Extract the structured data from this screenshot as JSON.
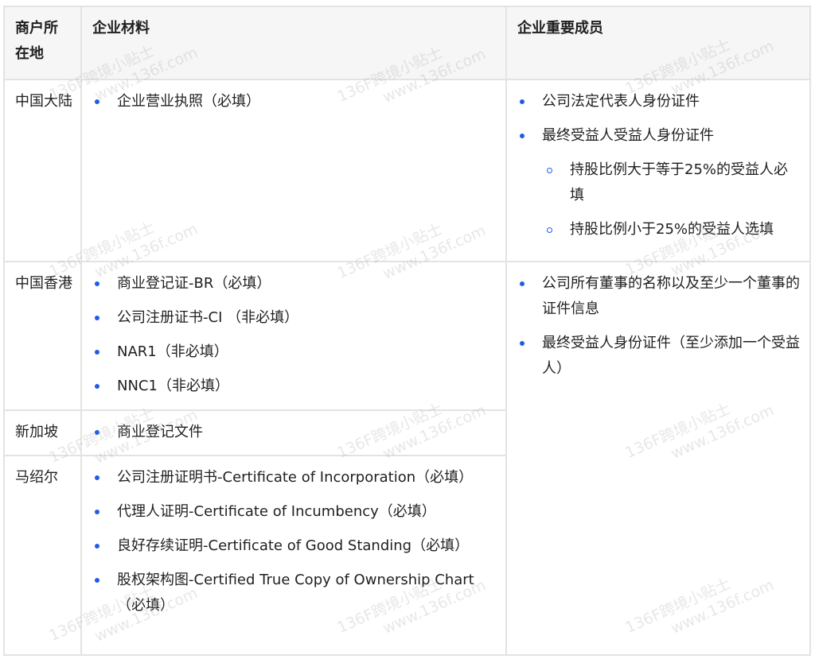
{
  "table": {
    "headers": [
      "商户所在地",
      "企业材料",
      "企业重要成员"
    ],
    "rows": [
      {
        "region": "中国大陆",
        "materials": [
          "企业营业执照（必填）"
        ],
        "members": [
          {
            "text": "公司法定代表人身份证件",
            "children": []
          },
          {
            "text": "最终受益人受益人身份证件",
            "children": [
              "持股比例大于等于25%的受益人必填",
              "持股比例小于25%的受益人选填"
            ]
          }
        ]
      },
      {
        "region": "中国香港",
        "materials": [
          "商业登记证-BR（必填）",
          "公司注册证书-CI （非必填）",
          "NAR1（非必填）",
          "NNC1（非必填）"
        ],
        "members": [
          {
            "text": "公司所有董事的名称以及至少一个董事的证件信息",
            "children": []
          },
          {
            "text": "最终受益人身份证件（至少添加一个受益人）",
            "children": []
          }
        ]
      },
      {
        "region": "新加坡",
        "materials": [
          "商业登记文件"
        ]
      },
      {
        "region": "马绍尔",
        "materials": [
          "公司注册证明书-Certificate of Incorporation（必填）",
          "代理人证明-Certificate of Incumbency（必填）",
          "良好存续证明-Certificate of Good Standing（必填）",
          "股权架构图-Certified True Copy of Ownership Chart（必填）"
        ]
      }
    ]
  },
  "watermark": {
    "line1": "136F跨境小贴士",
    "line2": "www.136f.com"
  },
  "colors": {
    "bullet": "#1f5ce6",
    "header_bg": "#f6f6f6",
    "border": "#e3e3e3"
  }
}
